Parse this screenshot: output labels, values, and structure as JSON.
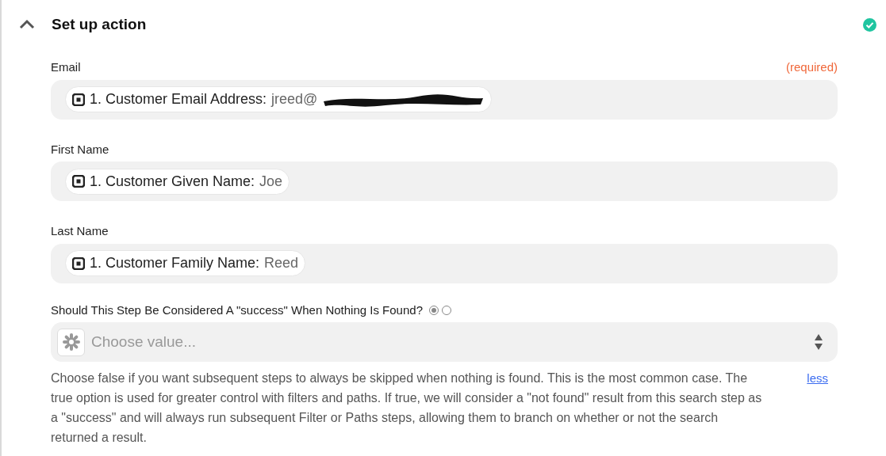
{
  "section": {
    "title": "Set up action",
    "expanded": true,
    "complete": true
  },
  "fields": [
    {
      "label": "Email",
      "required_note": "(required)",
      "pill": {
        "name": "1. Customer Email Address:",
        "value": "jreed@",
        "redacted": true
      }
    },
    {
      "label": "First Name",
      "pill": {
        "name": "1. Customer Given Name:",
        "value": "Joe"
      }
    },
    {
      "label": "Last Name",
      "pill": {
        "name": "1. Customer Family Name:",
        "value": "Reed"
      }
    }
  ],
  "question": {
    "label": "Should This Step Be Considered A \"success\" When Nothing Is Found?",
    "radios": [
      {
        "selected": true
      },
      {
        "selected": false
      }
    ],
    "placeholder": "Choose value...",
    "help": "Choose false if you want subsequent steps to always be skipped when nothing is found. This is the most common case. The true option is used for greater control with filters and paths. If true, we will consider a \"not found\" result from this search step as a \"success\" and will always run subsequent Filter or Paths steps, allowing them to branch on whether or not the search returned a result.",
    "toggle": "less"
  }
}
